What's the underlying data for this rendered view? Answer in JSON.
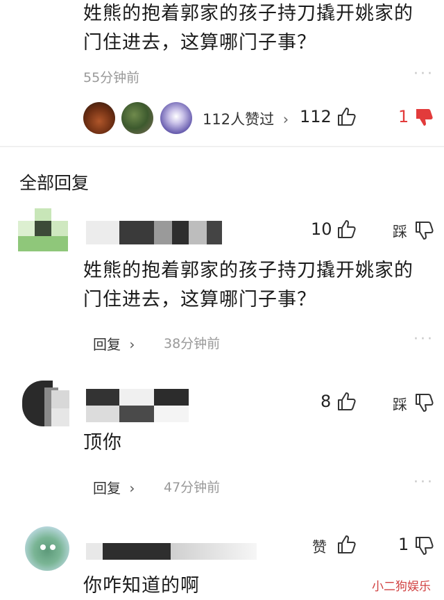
{
  "top_comment": {
    "text_line1": "姓熊的抱着郭家的孩子持刀撬开姚家的",
    "text_line2": "门住进去，这算哪门子事？",
    "time": "55分钟前",
    "likers_text": "112人赞过",
    "likers_arrow": "›",
    "like_count": "112",
    "dislike_count": "1",
    "more": "···"
  },
  "section_title": "全部回复",
  "replies": [
    {
      "like_count": "10",
      "dislike_label": "踩",
      "text_line1": "姓熊的抱着郭家的孩子持刀撬开姚家的",
      "text_line2": "门住进去，这算哪门子事？",
      "reply_label": "回复",
      "reply_arrow": "›",
      "time": "38分钟前",
      "more": "···"
    },
    {
      "like_count": "8",
      "dislike_label": "踩",
      "text": "顶你",
      "reply_label": "回复",
      "reply_arrow": "›",
      "time": "47分钟前",
      "more": "···"
    },
    {
      "like_label": "赞",
      "dislike_count": "1",
      "text": "你咋知道的啊"
    }
  ],
  "watermark": "小二狗娱乐",
  "icons": {
    "like": "thumbs-up-icon",
    "dislike": "thumbs-down-icon",
    "more": "more-dots-icon"
  },
  "colors": {
    "dislike_active": "#e23b3b"
  }
}
